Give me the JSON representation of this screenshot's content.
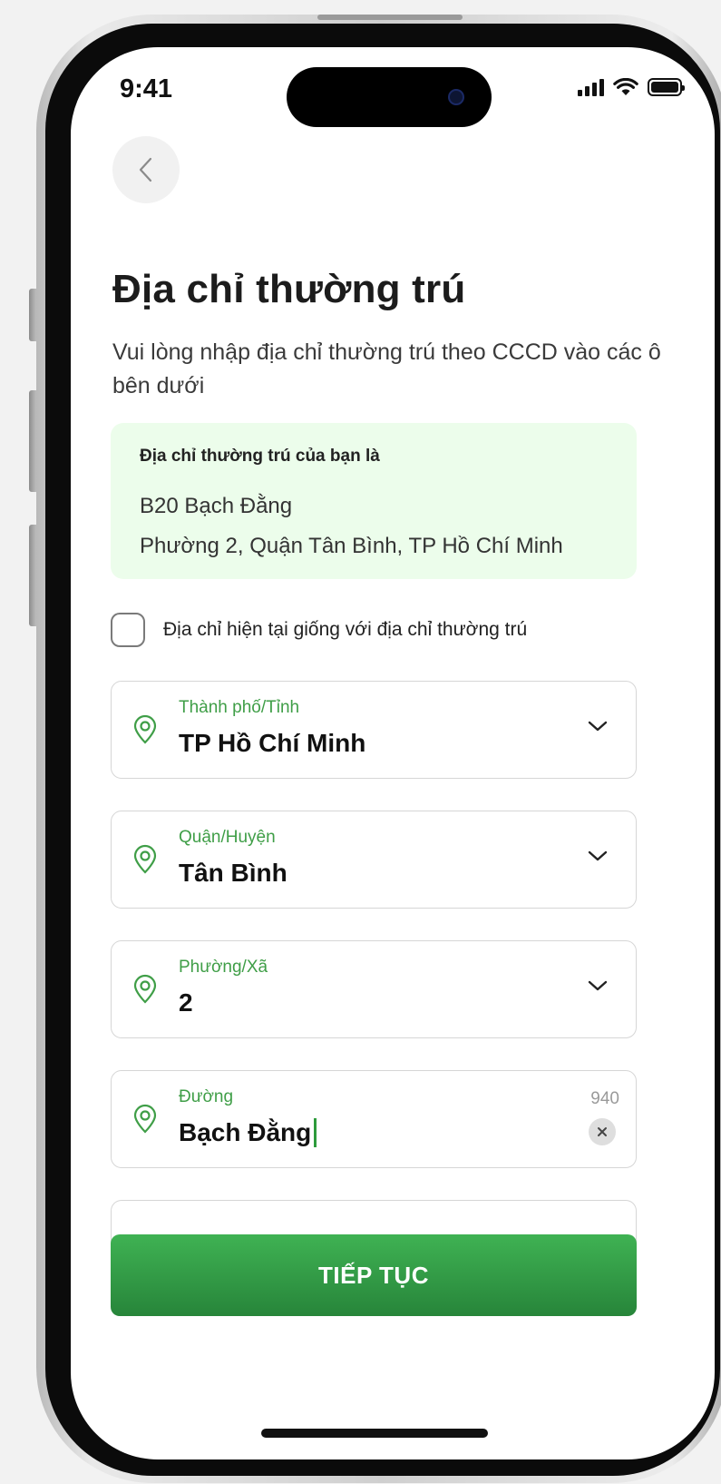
{
  "status_bar": {
    "time": "9:41"
  },
  "header": {
    "title": "Địa chỉ thường trú",
    "subtitle": "Vui lòng nhập địa chỉ thường trú theo CCCD vào các ô bên dưới"
  },
  "summary_card": {
    "label": "Địa chỉ thường trú của bạn là",
    "line1": "B20 Bạch Đằng",
    "line2": "Phường 2, Quận Tân Bình, TP Hồ Chí Minh",
    "background_color": "#ecfdeb"
  },
  "same_address": {
    "label": "Địa chỉ hiện tại giống với địa chỉ thường trú",
    "checked": false
  },
  "fields": {
    "city": {
      "label": "Thành phố/Tỉnh",
      "value": "TP Hồ Chí Minh"
    },
    "district": {
      "label": "Quận/Huyện",
      "value": "Tân Bình"
    },
    "ward": {
      "label": "Phường/Xã",
      "value": "2"
    },
    "street": {
      "label": "Đường",
      "value": "Bạch Đằng",
      "counter": "940"
    }
  },
  "cta": {
    "label": "TIẾP TỤC"
  },
  "colors": {
    "accent": "#3f9e47",
    "button_top": "#3fb253",
    "button_bottom": "#27853a"
  },
  "icons": {
    "back": "chevron-left-icon",
    "field": "location-pin-icon",
    "dropdown": "chevron-down-icon",
    "clear": "close-icon"
  }
}
